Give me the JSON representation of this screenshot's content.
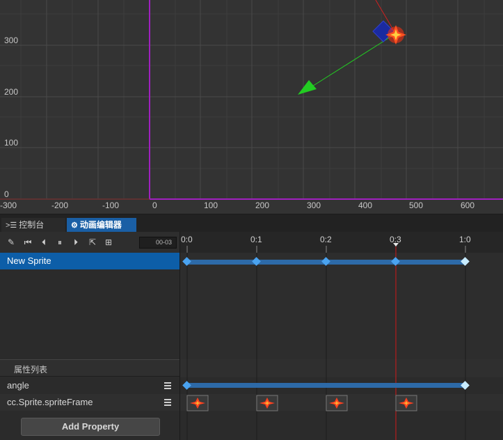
{
  "scene": {
    "x_tick_labels": [
      "-300",
      "-200",
      "-100",
      "0",
      "100",
      "200",
      "300",
      "400",
      "500",
      "600"
    ],
    "y_tick_labels": [
      "300",
      "200",
      "100",
      "0"
    ],
    "colors": {
      "origin_axis": "#a020c0",
      "arrow": "#22cc22",
      "red_line": "#d02020",
      "sprite_box": "#1a2aa0"
    }
  },
  "tabs": [
    {
      "label": "控制台",
      "icon": "console-icon"
    },
    {
      "label": "动画编辑器",
      "icon": "animation-icon"
    }
  ],
  "toolbar": {
    "buttons": [
      "edit-icon",
      "jump-first-icon",
      "prev-frame-icon",
      "pause-icon",
      "next-frame-icon",
      "external-link-icon",
      "add-event-icon"
    ],
    "time_value": "00-03"
  },
  "node_list": {
    "node_name": "New Sprite"
  },
  "timeline": {
    "ticks": [
      "0:0",
      "0:1",
      "0:2",
      "0:3",
      "1:0"
    ],
    "current_time": "0:3",
    "colors": {
      "track": "#2d6aa8",
      "keyframe": "#4aa3f0",
      "last_keyframe": "#c8ecff",
      "cursor": "#d01818"
    }
  },
  "properties": {
    "header": "属性列表",
    "rows": [
      {
        "name": "angle"
      },
      {
        "name": "cc.Sprite.spriteFrame"
      }
    ],
    "add_button": "Add Property"
  }
}
